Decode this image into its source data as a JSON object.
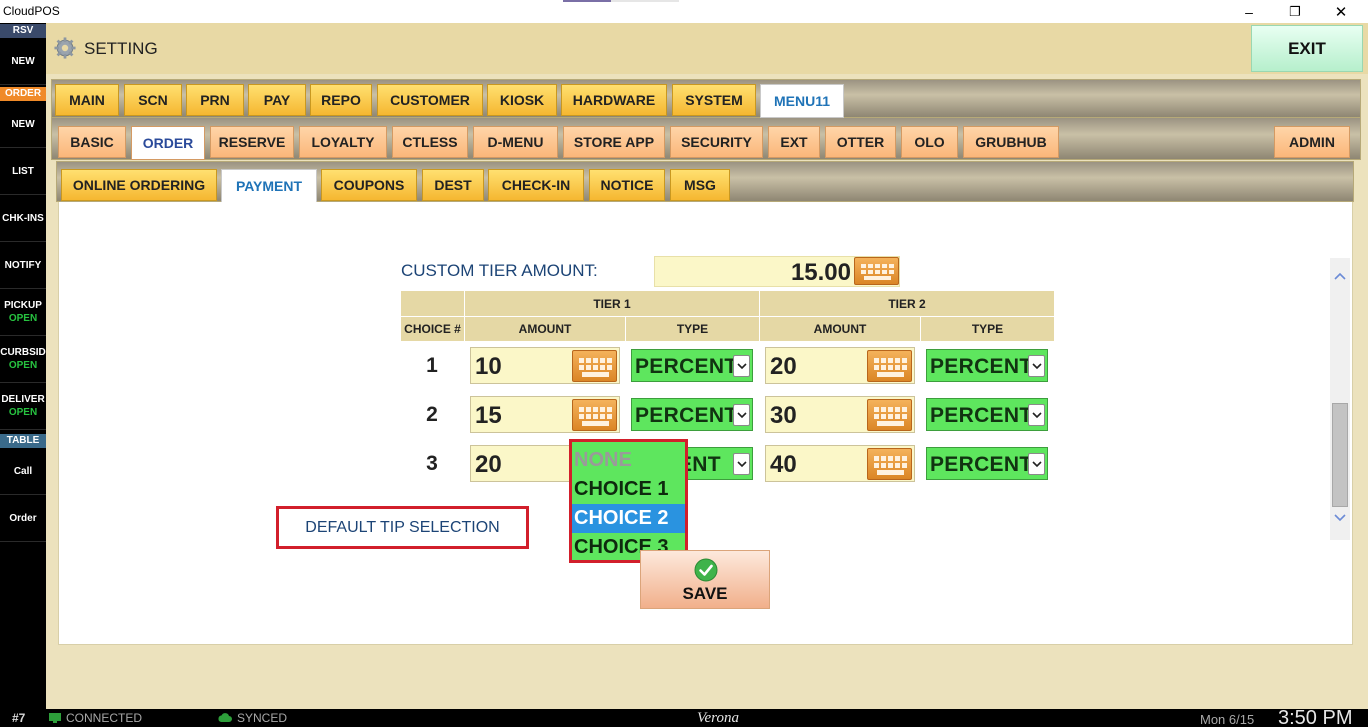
{
  "window": {
    "title": "CloudPOS",
    "minimize_icon": "–",
    "maximize_icon": "❐",
    "close_icon": "✕"
  },
  "colors": {
    "sidebar_bg": "#000000",
    "header_bg": "#e8d9a5",
    "tab_yellow": "#f5b731",
    "tab_orange": "#fab77a",
    "select_green": "#5ee65e",
    "highlight_blue": "#2a93e0",
    "annotation_red": "#d21f2b"
  },
  "sidebar": {
    "sections": {
      "rsv": "RSV",
      "order": "ORDER",
      "table": "TABLE"
    },
    "items": [
      {
        "label": "NEW",
        "sub": ""
      },
      {
        "label": "NEW",
        "sub": ""
      },
      {
        "label": "LIST",
        "sub": ""
      },
      {
        "label": "CHK-INS",
        "sub": ""
      },
      {
        "label": "NOTIFY",
        "sub": ""
      },
      {
        "label": "PICKUP",
        "sub": "OPEN"
      },
      {
        "label": "CURBSID",
        "sub": "OPEN"
      },
      {
        "label": "DELIVER",
        "sub": "OPEN"
      },
      {
        "label": "Call",
        "sub": ""
      },
      {
        "label": "Order",
        "sub": ""
      }
    ]
  },
  "header": {
    "title": "SETTING",
    "exit_label": "EXIT"
  },
  "tabs_main": [
    "MAIN",
    "SCN",
    "PRN",
    "PAY",
    "REPO",
    "CUSTOMER",
    "KIOSK",
    "HARDWARE",
    "SYSTEM",
    "MENU11"
  ],
  "tabs_sub": [
    "BASIC",
    "ORDER",
    "RESERVE",
    "LOYALTY",
    "CTLESS",
    "D-MENU",
    "STORE APP",
    "SECURITY",
    "EXT",
    "OTTER",
    "OLO",
    "GRUBHUB",
    "ADMIN"
  ],
  "tabs_third": [
    "ONLINE ORDERING",
    "PAYMENT",
    "COUPONS",
    "DEST",
    "CHECK-IN",
    "NOTICE",
    "MSG"
  ],
  "form": {
    "custom_tier_label": "CUSTOM TIER AMOUNT:",
    "custom_tier_value": "15.00",
    "headers": {
      "tier1": "TIER 1",
      "tier2": "TIER 2",
      "choice": "CHOICE #",
      "amount": "AMOUNT",
      "type": "TYPE"
    },
    "rows": [
      {
        "choice": "1",
        "t1_amount": "10",
        "t1_type": "PERCENT",
        "t2_amount": "20",
        "t2_type": "PERCENT"
      },
      {
        "choice": "2",
        "t1_amount": "15",
        "t1_type": "PERCENT",
        "t2_amount": "30",
        "t2_type": "PERCENT"
      },
      {
        "choice": "3",
        "t1_amount": "20",
        "t1_type": "ENT",
        "t2_amount": "40",
        "t2_type": "PERCENT"
      }
    ],
    "default_tip_label": "DEFAULT TIP SELECTION",
    "dropdown_options": [
      "NONE",
      "CHOICE 1",
      "CHOICE 2",
      "CHOICE 3"
    ],
    "save_label": "SAVE"
  },
  "statusbar": {
    "station": "#7",
    "connection": "CONNECTED",
    "sync": "SYNCED",
    "store": "Verona",
    "date": "Mon 6/15",
    "time": "3:50 PM"
  }
}
